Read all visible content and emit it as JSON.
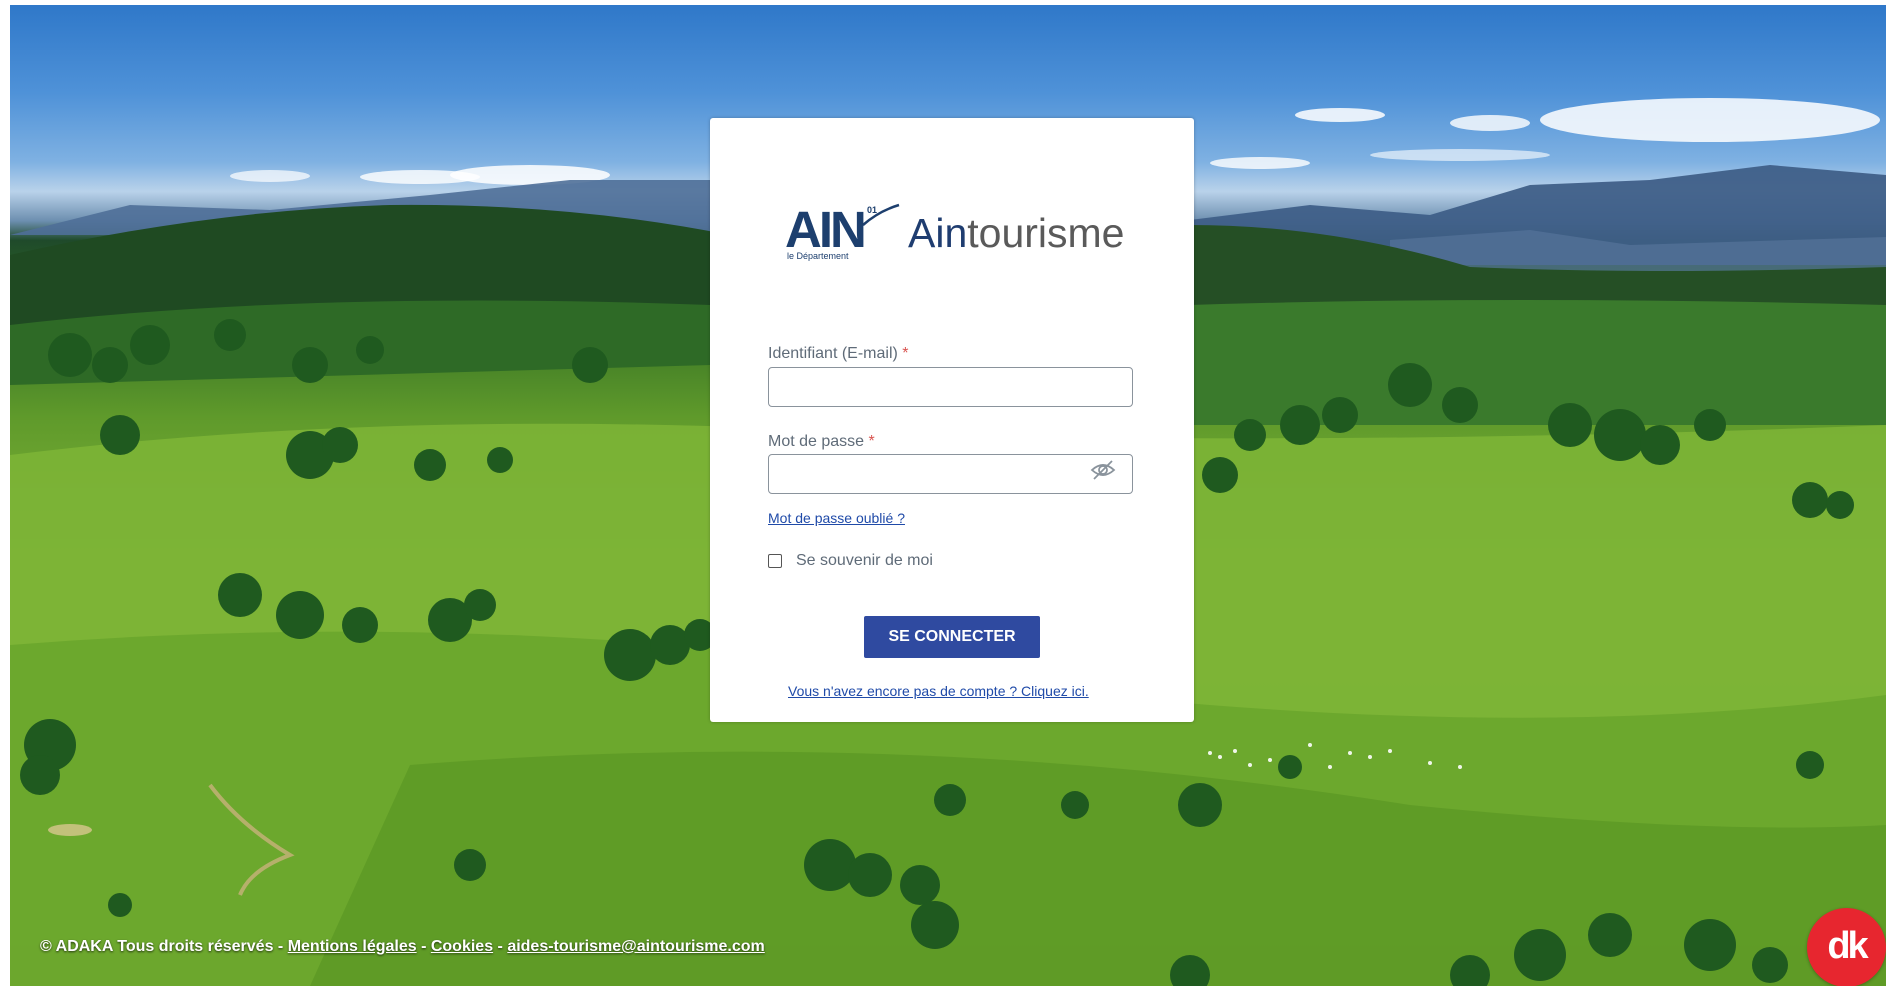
{
  "colors": {
    "primary_button": "#2f4aa0",
    "link": "#1f4aa8",
    "required_marker": "#d9534f",
    "logo_blue": "#1d3f6e",
    "dk_badge": "#e7262f"
  },
  "logo": {
    "ain": "AIN",
    "badge_number": "01",
    "department": "le Département",
    "wordmark_part1": "Ain",
    "wordmark_part2": "tourisme"
  },
  "form": {
    "email_label": "Identifiant (E-mail)",
    "email_value": "",
    "password_label": "Mot de passe",
    "password_value": "",
    "required_marker": "*",
    "password_toggle_icon": "eye-slash-icon",
    "forgot_password_link": "Mot de passe oublié ?",
    "remember_me_label": "Se souvenir de moi",
    "remember_me_checked": false,
    "submit_label": "SE CONNECTER",
    "signup_link": "Vous n'avez encore pas de compte ? Cliquez ici."
  },
  "footer": {
    "copyright": "© ADAKA Tous droits réservés",
    "separator": " - ",
    "mentions_link": "Mentions légales",
    "cookies_link": "Cookies",
    "email_link": "aides-tourisme@aintourisme.com"
  },
  "dk_badge": {
    "text": "dk",
    "icon": "adaka-logo-icon"
  }
}
